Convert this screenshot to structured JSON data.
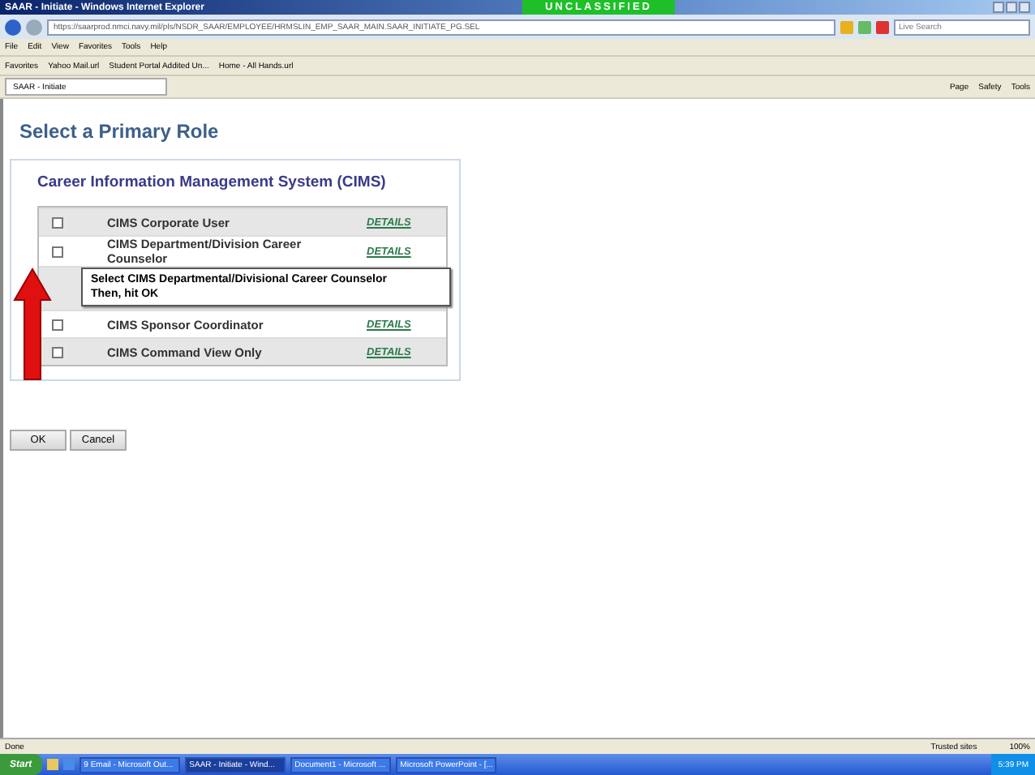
{
  "window": {
    "title": "SAAR - Initiate - Windows Internet Explorer",
    "banner": "UNCLASSIFIED"
  },
  "address_bar": {
    "url": "https://saarprod.nmci.navy.mil/pls/NSDR_SAAR/EMPLOYEE/HRMSLIN_EMP_SAAR_MAIN.SAAR_INITIATE_PG.SEL",
    "search_placeholder": "Live Search"
  },
  "menu": [
    "File",
    "Edit",
    "View",
    "Favorites",
    "Tools",
    "Help"
  ],
  "favorites": [
    "Favorites",
    "Yahoo Mail.url",
    "Student Portal Addited Un...",
    "Home - All Hands.url"
  ],
  "tabs": [
    {
      "label": "SAAR - Initiate",
      "selected": true
    }
  ],
  "command_bar": [
    "Page",
    "Safety",
    "Tools"
  ],
  "page": {
    "title": "Select a Primary Role",
    "section_title": "Career Information Management System (CIMS)",
    "roles": [
      {
        "kind": "role",
        "name": "CIMS Corporate User",
        "link": "DETAILS",
        "checked": false
      },
      {
        "kind": "role",
        "name": "CIMS Department/Division Career Counselor",
        "link": "DETAILS",
        "checked": false
      },
      {
        "kind": "covered"
      },
      {
        "kind": "role",
        "name": "CIMS Sponsor Coordinator",
        "link": "DETAILS",
        "checked": false
      },
      {
        "kind": "role",
        "name": "CIMS Command View Only",
        "link": "DETAILS",
        "checked": false
      }
    ],
    "callout": [
      "Select CIMS Departmental/Divisional Career Counselor",
      "Then, hit OK"
    ],
    "buttons": [
      "OK",
      "Cancel"
    ]
  },
  "status_bar": {
    "status": "Done",
    "zone": "Trusted sites",
    "zoom": "100%"
  },
  "taskbar": {
    "start": "Start",
    "items": [
      {
        "label": "9 Email - Microsoft Out...",
        "selected": false
      },
      {
        "label": "SAAR - Initiate - Wind...",
        "selected": true
      },
      {
        "label": "Document1 - Microsoft ...",
        "selected": false
      },
      {
        "label": "Microsoft PowerPoint - [...",
        "selected": false
      }
    ],
    "clock": "5:39 PM"
  }
}
